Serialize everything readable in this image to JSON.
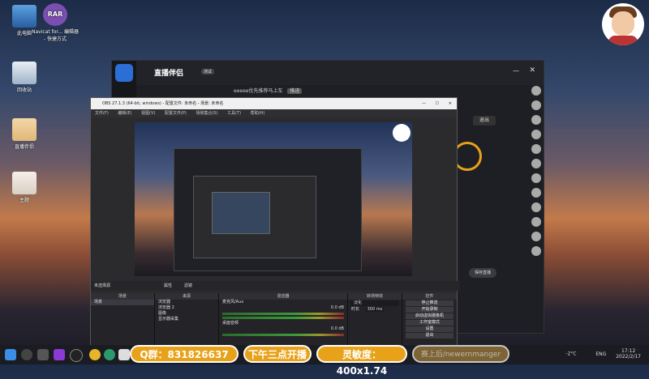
{
  "desktop": {
    "icons": [
      {
        "label": "此电脑"
      },
      {
        "label": "Navicat for... 编辑器 - 快捷方式"
      },
      {
        "label": "回收站"
      },
      {
        "label": "直播伴侣"
      },
      {
        "label": "主题"
      }
    ],
    "rar_label": "RAR"
  },
  "app": {
    "title": "直播伴侣",
    "badge": "测试",
    "tab_text": "eeeee优先推荐马上车",
    "btn_go": "推进",
    "right_btn": "退出",
    "bottom_btn": "保存直播"
  },
  "obs": {
    "title": "OBS 27.1.3 (64-bit, windows) - 配置文件: 未命名 - 场景: 未命名",
    "menu": [
      "文件(F)",
      "编辑(E)",
      "视图(V)",
      "配置文件(P)",
      "场景集合(S)",
      "工具(T)",
      "帮助(H)"
    ],
    "no_source": "未选择源",
    "props_label": "属性",
    "filter_label": "滤镜",
    "panels": {
      "scenes": "场景",
      "sources": "来源",
      "mixer": "混音器",
      "transitions": "转场特效",
      "controls": "控件"
    },
    "scene_item": "场景",
    "sources": [
      "浏览器",
      "浏览器 2",
      "图像",
      "显示器采集"
    ],
    "mixer_tracks": [
      {
        "name": "麦克风/Aux",
        "db": "0.0 dB"
      },
      {
        "name": "桌面音频",
        "db": "0.0 dB"
      }
    ],
    "transition": {
      "name": "淡化",
      "duration_label": "时长",
      "duration": "300 ms"
    },
    "controls": [
      "停止推流",
      "开始录制",
      "启动虚拟摄像机",
      "工作室模式",
      "设置",
      "退出"
    ]
  },
  "overlay": {
    "pills": [
      "Q群：831826637",
      "下午三点开播",
      "灵敏度：400x1.74",
      "赛上后/newernmanger"
    ]
  },
  "taskbar": {
    "temperature": "-2°C",
    "lang": "ENG",
    "time": "17:12",
    "date": "2022/2/17"
  },
  "colors": {
    "accent_orange": "#e8a21a",
    "obs_bg": "#2b2b2e"
  }
}
